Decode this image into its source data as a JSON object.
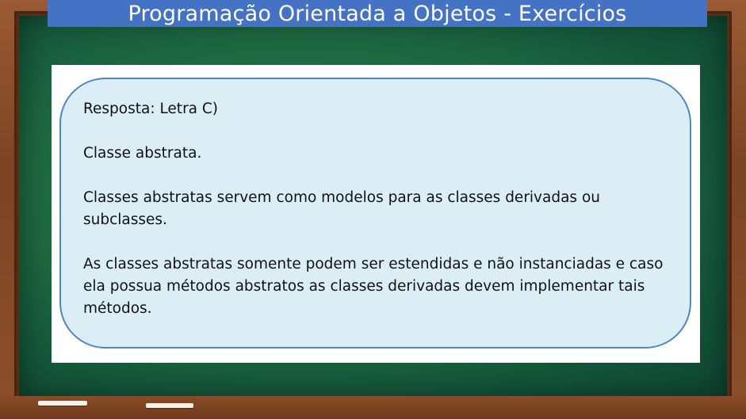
{
  "title": "Programação Orientada a Objetos - Exercícios",
  "answer": {
    "heading": "Resposta: Letra C)",
    "concept": "Classe abstrata.",
    "paragraph1": "Classes abstratas servem como modelos para as classes derivadas ou subclasses.",
    "paragraph2": "As classes abstratas somente podem ser estendidas e não instanciadas e caso ela possua métodos abstratos as classes derivadas devem implementar tais métodos."
  },
  "colors": {
    "title_bar": "#4472c4",
    "board": "#1f6a42",
    "bubble_fill": "#dbeef5",
    "bubble_border": "#4f86c6",
    "frame": "#8d4f2b"
  }
}
